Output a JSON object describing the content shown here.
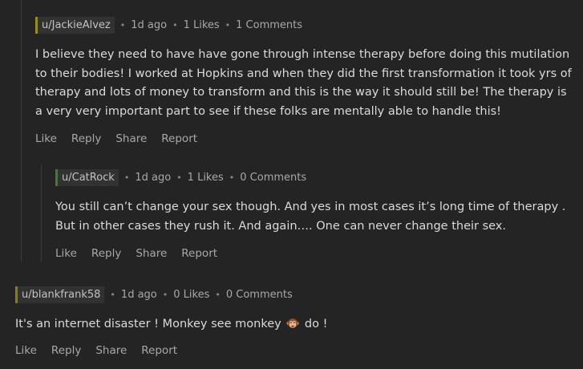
{
  "comments": [
    {
      "username": "u/JackieAlvez",
      "time": "1d ago",
      "likes": "1 Likes",
      "comments": "1 Comments",
      "body": "I believe they need to have have gone through intense therapy before doing this mutilation to their bodies! I worked at Hopkins and when they did the first transformation it took yrs of therapy and lots of money to transform and this is the way it should still be! The therapy is a very very important part to see if these folks are mentally able to handle this!",
      "actions": [
        "Like",
        "Reply",
        "Share",
        "Report"
      ]
    },
    {
      "username": "u/CatRock",
      "time": "1d ago",
      "likes": "1 Likes",
      "comments": "0 Comments",
      "body": "You still can’t change your sex though. And yes in most cases it’s ￼long time of therapy . But in other cases they rush it. And again…. One can never change their sex.",
      "actions": [
        "Like",
        "Reply",
        "Share",
        "Report"
      ]
    },
    {
      "username": "u/blankfrank58",
      "time": "1d ago",
      "likes": "0 Likes",
      "comments": "0 Comments",
      "body_before": "It's an internet disaster ! Monkey see monkey",
      "body_after": "do !",
      "emoji": "monkey-face-icon",
      "actions": [
        "Like",
        "Reply",
        "Share",
        "Report"
      ]
    }
  ],
  "meta_separator": "•"
}
